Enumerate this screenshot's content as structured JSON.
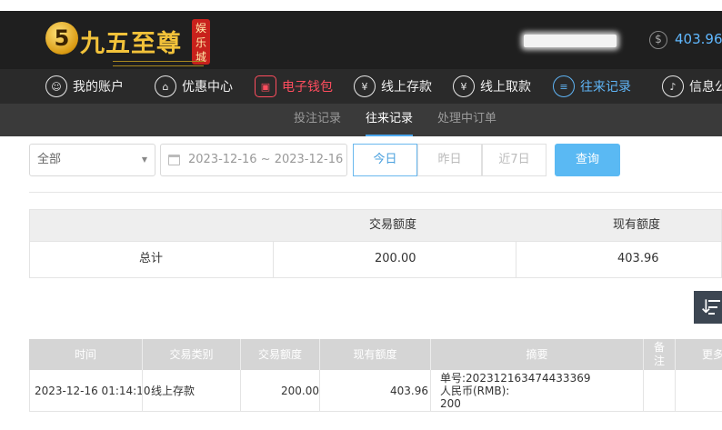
{
  "brand": {
    "badge": "5",
    "name": "九五至尊",
    "seal": "娱乐城"
  },
  "account": {
    "balance": "403.96",
    "currency_symbol": "$"
  },
  "nav": [
    {
      "id": "account",
      "label": "我的账户",
      "glyph": "☺"
    },
    {
      "id": "promo",
      "label": "优惠中心",
      "glyph": "⌂"
    },
    {
      "id": "wallet",
      "label": "电子钱包",
      "glyph": "▣"
    },
    {
      "id": "deposit",
      "label": "线上存款",
      "glyph": "¥"
    },
    {
      "id": "withdraw",
      "label": "线上取款",
      "glyph": "¥"
    },
    {
      "id": "records",
      "label": "往来记录",
      "glyph": "≡"
    },
    {
      "id": "messages",
      "label": "信息公",
      "glyph": "♪"
    }
  ],
  "subnav": [
    {
      "label": "投注记录"
    },
    {
      "label": "往来记录"
    },
    {
      "label": "处理中订单"
    }
  ],
  "filter": {
    "type_value": "全部",
    "date_range": "2023-12-16 ~ 2023-12-16",
    "quick": [
      "今日",
      "昨日",
      "近7日"
    ],
    "query_label": "查询"
  },
  "summary": {
    "headers": [
      "交易额度",
      "现有额度"
    ],
    "label": "总计",
    "amount": "200.00",
    "balance": "403.96"
  },
  "table": {
    "headers": [
      "时间",
      "交易类别",
      "交易额度",
      "现有额度",
      "摘要",
      "备注",
      "更多"
    ],
    "rows": [
      {
        "time": "2023-12-16 01:14:10",
        "type": "线上存款",
        "amount": "200.00",
        "balance": "403.96",
        "summary_lines": [
          "单号:202312163474433369",
          "人民币(RMB):",
          "200"
        ],
        "note": "",
        "more": ""
      }
    ]
  },
  "colors": {
    "accent": "#5ab9f3",
    "wallet": "#ff4d5e",
    "active_nav": "#5fb4f5",
    "header_bg": "#1f1f1f"
  }
}
